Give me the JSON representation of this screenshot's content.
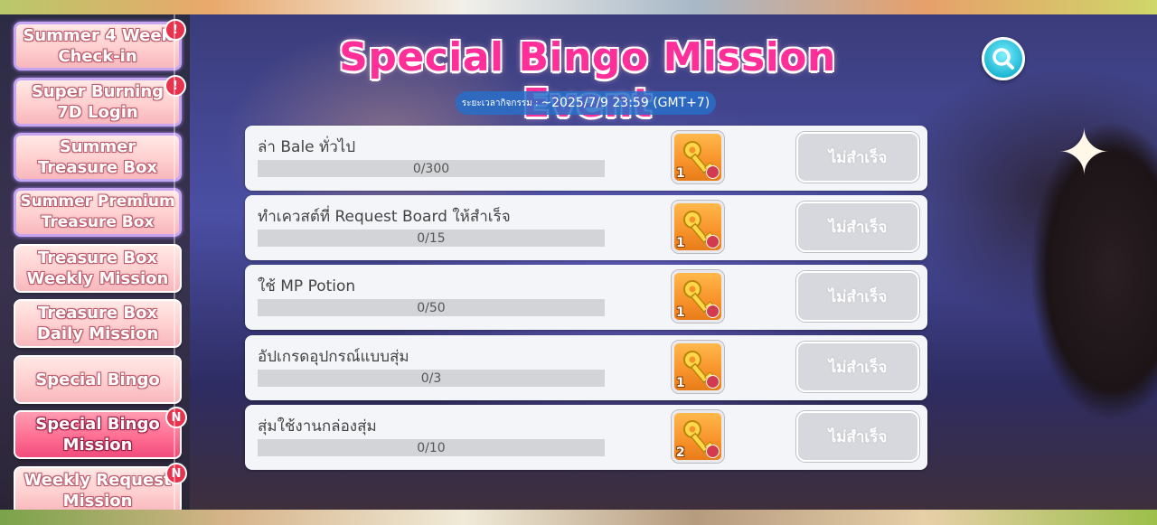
{
  "header": {
    "title": "Special Bingo Mission Event",
    "period_label": "ระยะเวลากิจกรรม :",
    "period_value": "~2025/7/9 23:59 (GMT+7)"
  },
  "sidebar": {
    "items": [
      {
        "label": "Summer 4 Week Check-in",
        "badge": "!"
      },
      {
        "label": "Super Burning 7D Login",
        "badge": "!"
      },
      {
        "label": "Summer Treasure Box",
        "badge": ""
      },
      {
        "label": "Summer Premium Treasure Box",
        "badge": ""
      },
      {
        "label": "Treasure Box Weekly Mission",
        "badge": ""
      },
      {
        "label": "Treasure Box Daily Mission",
        "badge": ""
      },
      {
        "label": "Special Bingo",
        "badge": ""
      },
      {
        "label": "Special Bingo Mission",
        "badge": "N"
      },
      {
        "label": "Weekly Request Mission",
        "badge": "N"
      }
    ],
    "active_item": "Special Bingo Mission"
  },
  "missions": [
    {
      "name": "ล่า Bale ทั่วไป",
      "progress_text": "0/300",
      "progress": 0,
      "reward_qty": "1",
      "reward_icon": "golden-key-icon",
      "status": "ไม่สำเร็จ"
    },
    {
      "name": "ทำเควสต์ที่ Request Board ให้สำเร็จ",
      "progress_text": "0/15",
      "progress": 0,
      "reward_qty": "1",
      "reward_icon": "golden-key-icon",
      "status": "ไม่สำเร็จ"
    },
    {
      "name": "ใช้ MP Potion",
      "progress_text": "0/50",
      "progress": 0,
      "reward_qty": "1",
      "reward_icon": "golden-key-icon",
      "status": "ไม่สำเร็จ"
    },
    {
      "name": "อัปเกรดอุปกรณ์แบบสุ่ม",
      "progress_text": "0/3",
      "progress": 0,
      "reward_qty": "1",
      "reward_icon": "golden-key-icon",
      "status": "ไม่สำเร็จ"
    },
    {
      "name": "สุ่มใช้งานกล่องสุ่ม",
      "progress_text": "0/10",
      "progress": 0,
      "reward_qty": "2",
      "reward_icon": "golden-key-icon",
      "status": "ไม่สำเร็จ"
    }
  ],
  "colors": {
    "title": "#ff2f9a",
    "sidebar_active": "#f04c7c",
    "sidebar_default": "#ffcfcf",
    "badge": "#e8334f",
    "reward_bg": "#f7922a",
    "status_disabled": "#d7d8dd",
    "search_button": "#1fb8d4"
  },
  "icons": {
    "search": "search-icon"
  }
}
